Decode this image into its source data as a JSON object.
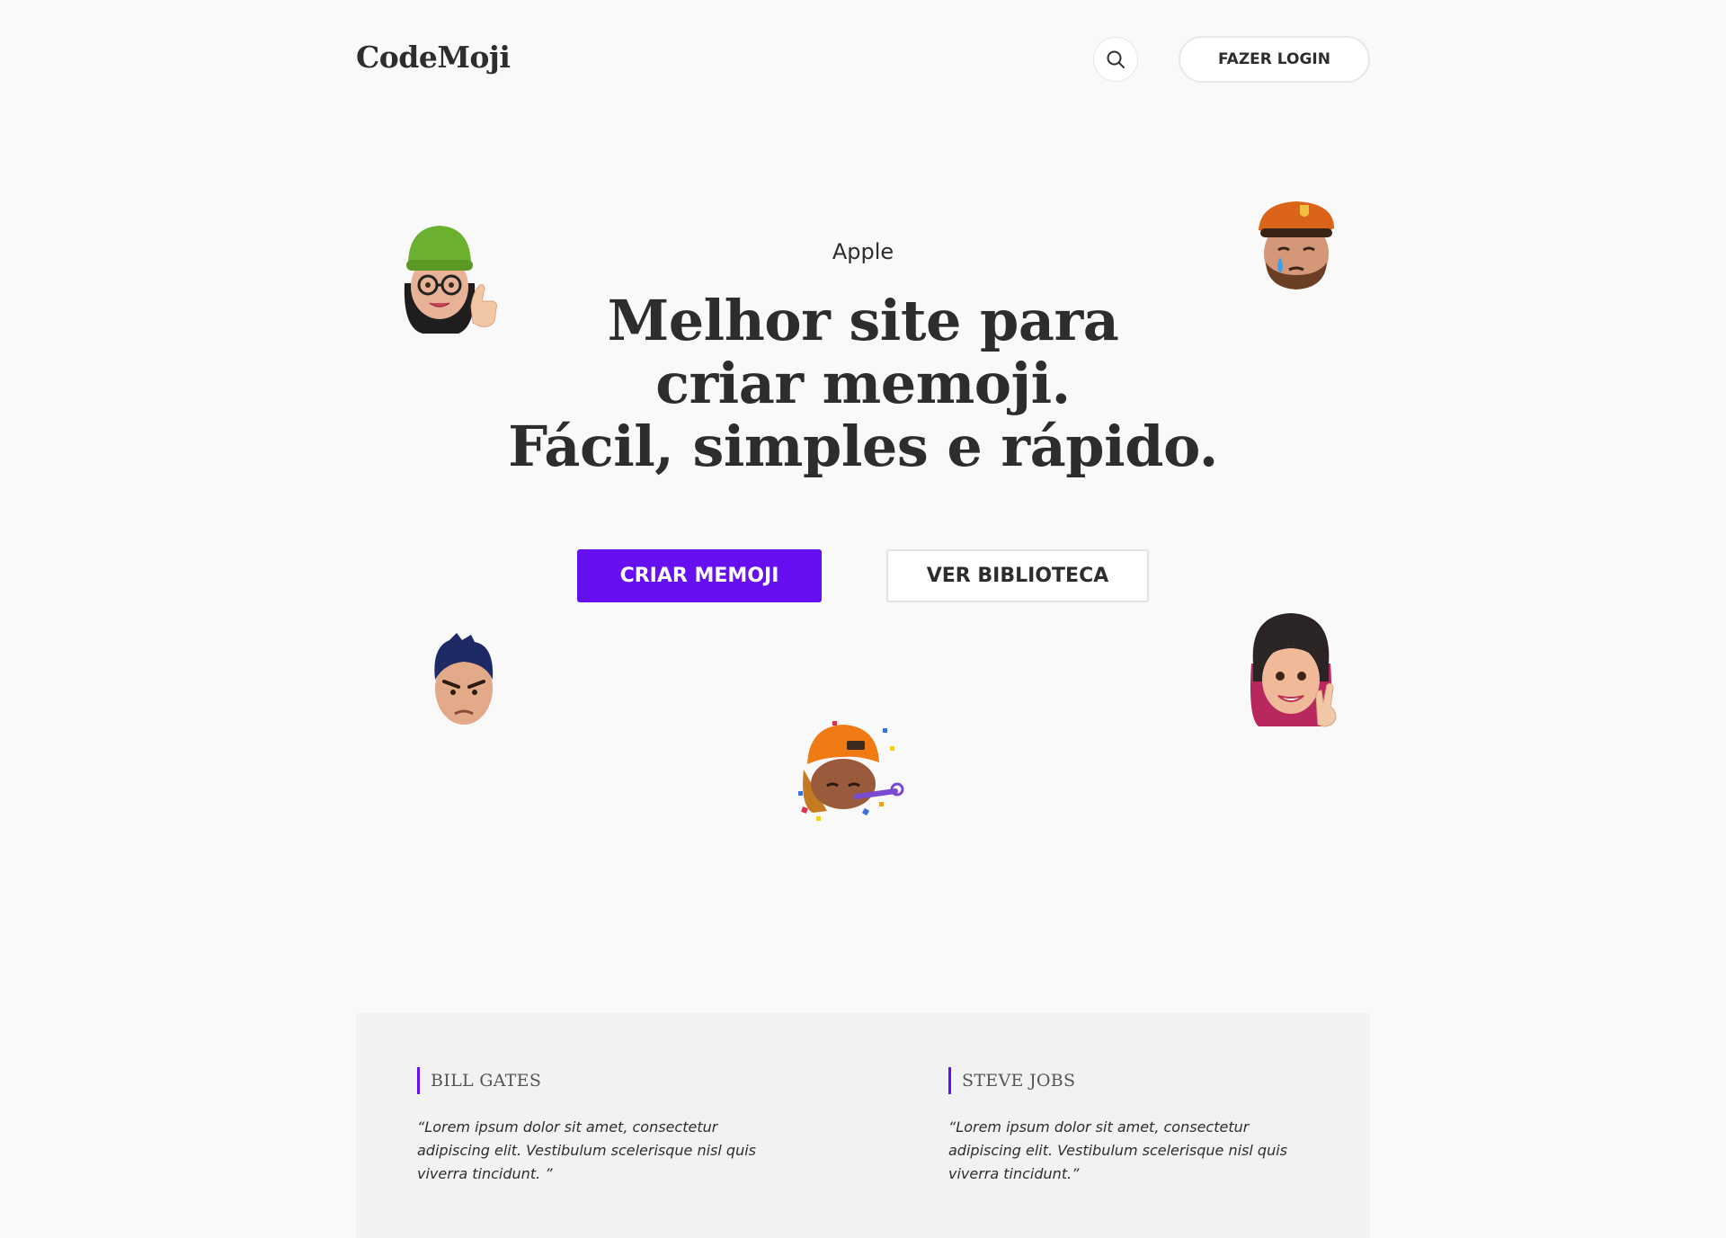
{
  "header": {
    "logo": "CodeMoji",
    "login_label": "FAZER LOGIN"
  },
  "hero": {
    "eyebrow": "Apple",
    "title_lines": [
      "Melhor site para",
      "criar memoji.",
      "Fácil, simples e rápido."
    ],
    "primary_cta": "CRIAR MEMOJI",
    "secondary_cta": "VER BIBLIOTECA"
  },
  "testimonials": [
    {
      "name": "BILL GATES",
      "quote": "“Lorem ipsum dolor sit amet, consectetur adipiscing elit. Vestibulum scelerisque nisl quis viverra tincidunt. ”"
    },
    {
      "name": "STEVE JOBS",
      "quote": "“Lorem ipsum dolor sit amet, consectetur adipiscing elit. Vestibulum scelerisque nisl quis viverra tincidunt.”"
    }
  ],
  "colors": {
    "background": "#f9f9f9",
    "accent": "#6610f2",
    "text": "#2d2d2d",
    "panel": "#f2f2f2"
  },
  "icons": {
    "search": "search-icon"
  }
}
